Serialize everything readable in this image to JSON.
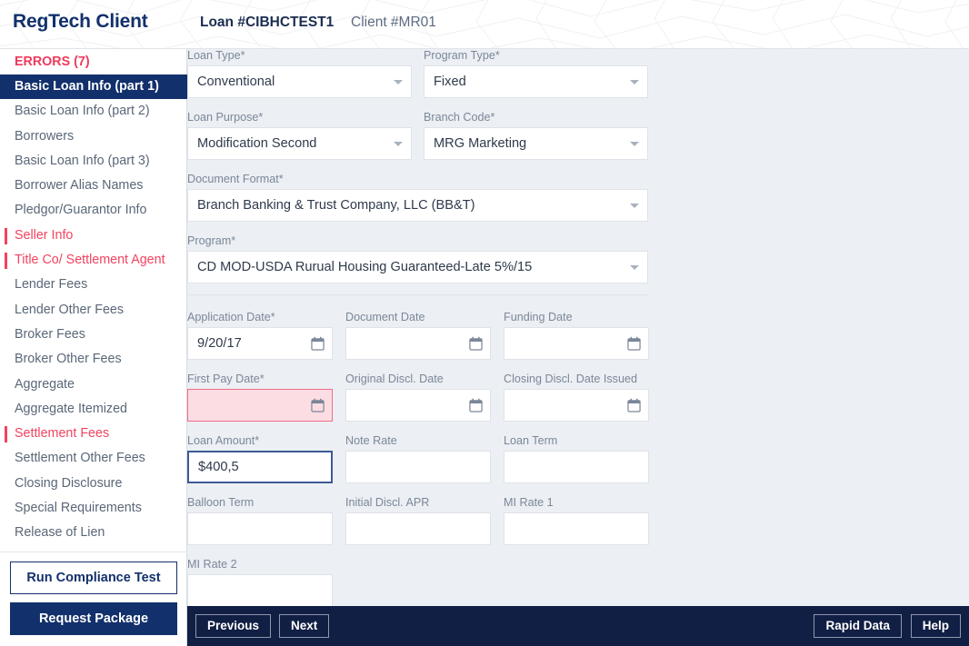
{
  "header": {
    "brand": "RegTech Client",
    "loan_id": "Loan #CIBHCTEST1",
    "client_id": "Client #MR01"
  },
  "sidebar": {
    "errors_label": "ERRORS (7)",
    "items": [
      {
        "label": "Basic Loan Info (part 1)",
        "state": "active"
      },
      {
        "label": "Basic Loan Info (part 2)",
        "state": "normal"
      },
      {
        "label": "Borrowers",
        "state": "normal"
      },
      {
        "label": "Basic Loan Info (part 3)",
        "state": "normal"
      },
      {
        "label": "Borrower Alias Names",
        "state": "normal"
      },
      {
        "label": "Pledgor/Guarantor Info",
        "state": "normal"
      },
      {
        "label": "Seller Info",
        "state": "error"
      },
      {
        "label": "Title Co/ Settlement Agent",
        "state": "error"
      },
      {
        "label": "Lender Fees",
        "state": "normal"
      },
      {
        "label": "Lender Other Fees",
        "state": "normal"
      },
      {
        "label": "Broker Fees",
        "state": "normal"
      },
      {
        "label": "Broker Other Fees",
        "state": "normal"
      },
      {
        "label": "Aggregate",
        "state": "normal"
      },
      {
        "label": "Aggregate Itemized",
        "state": "normal"
      },
      {
        "label": "Settlement Fees",
        "state": "error"
      },
      {
        "label": "Settlement Other Fees",
        "state": "normal"
      },
      {
        "label": "Closing Disclosure",
        "state": "normal"
      },
      {
        "label": "Special Requirements",
        "state": "normal"
      },
      {
        "label": "Release of Lien",
        "state": "normal"
      }
    ],
    "run_compliance_label": "Run Compliance Test",
    "request_package_label": "Request Package"
  },
  "form": {
    "loan_type": {
      "label": "Loan Type*",
      "value": "Conventional"
    },
    "program_type": {
      "label": "Program Type*",
      "value": "Fixed"
    },
    "loan_purpose": {
      "label": "Loan Purpose*",
      "value": "Modification Second"
    },
    "branch_code": {
      "label": "Branch Code*",
      "value": "MRG Marketing"
    },
    "document_format": {
      "label": "Document Format*",
      "value": "Branch Banking & Trust Company, LLC (BB&T)"
    },
    "program": {
      "label": "Program*",
      "value": "CD MOD-USDA Rurual Housing Guaranteed-Late 5%/15"
    },
    "application_date": {
      "label": "Application Date*",
      "value": "9/20/17"
    },
    "document_date": {
      "label": "Document Date",
      "value": ""
    },
    "funding_date": {
      "label": "Funding Date",
      "value": ""
    },
    "first_pay_date": {
      "label": "First Pay Date*",
      "value": ""
    },
    "original_discl_date": {
      "label": "Original Discl. Date",
      "value": ""
    },
    "closing_discl_date_issued": {
      "label": "Closing Discl. Date Issued",
      "value": ""
    },
    "loan_amount": {
      "label": "Loan Amount*",
      "value": "$400,5"
    },
    "note_rate": {
      "label": "Note Rate",
      "value": ""
    },
    "loan_term": {
      "label": "Loan Term",
      "value": ""
    },
    "balloon_term": {
      "label": "Balloon Term",
      "value": ""
    },
    "initial_discl_apr": {
      "label": "Initial Discl. APR",
      "value": ""
    },
    "mi_rate_1": {
      "label": "MI Rate 1",
      "value": ""
    },
    "mi_rate_2": {
      "label": "MI Rate 2",
      "value": ""
    }
  },
  "bottombar": {
    "previous": "Previous",
    "next": "Next",
    "rapid_data": "Rapid Data",
    "help": "Help"
  },
  "colors": {
    "brand_navy": "#12306b",
    "error_red": "#f2435f",
    "bottom_bar": "#111f44",
    "content_bg": "#eceff3"
  }
}
